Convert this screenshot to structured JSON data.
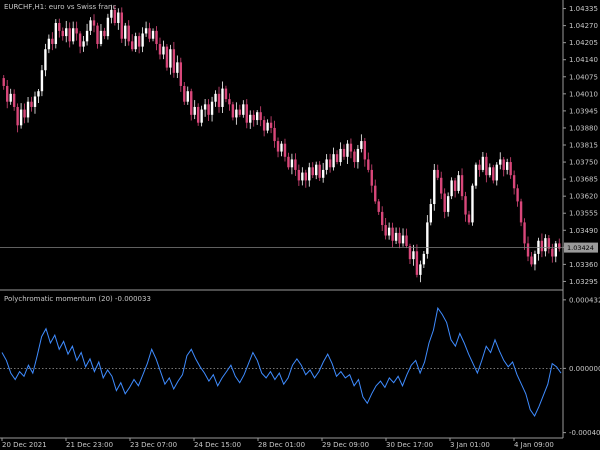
{
  "chart_title": "EURCHF,H1:  euro vs Swiss franc",
  "indicator_title": "Polychromatic momentum (20) -0.000033",
  "colors": {
    "background": "#000000",
    "up_candle": "#ffffff",
    "down_candle": "#d9477a",
    "indicator_line": "#3f8cff",
    "grid_line": "#9a9a9a",
    "current_price_line": "#808080",
    "price_tag": "#9a9a9a"
  },
  "chart_data": [
    {
      "type": "candlestick",
      "title": "EURCHF,H1:  euro vs Swiss franc",
      "y_ticks": [
        "1.04335",
        "1.04270",
        "1.04205",
        "1.04140",
        "1.04075",
        "1.04010",
        "1.03945",
        "1.03880",
        "1.03815",
        "1.03750",
        "1.03685",
        "1.03620",
        "1.03555",
        "1.03490",
        "1.03425",
        "1.03360",
        "1.03295"
      ],
      "ylim": [
        1.0327,
        1.0436
      ],
      "current_price": "1.03424",
      "x_ticks": [
        "20 Dec 2021",
        "21 Dec 23:00",
        "23 Dec 07:00",
        "24 Dec 15:00",
        "28 Dec 01:00",
        "29 Dec 09:00",
        "30 Dec 17:00",
        "3 Jan 01:00",
        "4 Jan 09:00"
      ],
      "close": [
        1.0404,
        1.0398,
        1.0401,
        1.0396,
        1.0389,
        1.0395,
        1.0392,
        1.0398,
        1.0396,
        1.04,
        1.0402,
        1.041,
        1.0418,
        1.0422,
        1.042,
        1.0428,
        1.0425,
        1.0423,
        1.0426,
        1.0421,
        1.0426,
        1.0424,
        1.0419,
        1.0421,
        1.0425,
        1.0429,
        1.0427,
        1.042,
        1.0425,
        1.0423,
        1.043,
        1.0433,
        1.0428,
        1.0432,
        1.0422,
        1.0427,
        1.0421,
        1.0418,
        1.0423,
        1.0419,
        1.0424,
        1.0426,
        1.0422,
        1.0425,
        1.042,
        1.0416,
        1.0419,
        1.0411,
        1.0418,
        1.0409,
        1.0413,
        1.0404,
        1.0398,
        1.0402,
        1.0393,
        1.0396,
        1.039,
        1.0395,
        1.0397,
        1.0393,
        1.0398,
        1.0401,
        1.0396,
        1.0403,
        1.0399,
        1.0397,
        1.0392,
        1.0395,
        1.0393,
        1.0397,
        1.039,
        1.0393,
        1.0391,
        1.0394,
        1.0391,
        1.0387,
        1.039,
        1.0388,
        1.0383,
        1.0379,
        1.0382,
        1.0377,
        1.0373,
        1.0376,
        1.0372,
        1.0368,
        1.0371,
        1.0368,
        1.0373,
        1.037,
        1.0374,
        1.0369,
        1.0372,
        1.0376,
        1.0373,
        1.0378,
        1.0375,
        1.038,
        1.0377,
        1.0382,
        1.0379,
        1.0375,
        1.038,
        1.0383,
        1.0376,
        1.0372,
        1.0366,
        1.036,
        1.0356,
        1.0351,
        1.0347,
        1.035,
        1.0345,
        1.0348,
        1.0344,
        1.0347,
        1.0343,
        1.0338,
        1.0341,
        1.0332,
        1.0336,
        1.034,
        1.0352,
        1.0359,
        1.0372,
        1.0369,
        1.0363,
        1.0356,
        1.0362,
        1.0368,
        1.0364,
        1.037,
        1.0362,
        1.0355,
        1.0352,
        1.0366,
        1.0374,
        1.0372,
        1.0377,
        1.037,
        1.0373,
        1.0368,
        1.0374,
        1.0376,
        1.0372,
        1.0375,
        1.037,
        1.0365,
        1.036,
        1.0352,
        1.0344,
        1.0339,
        1.0336,
        1.034,
        1.0345,
        1.0341,
        1.0346,
        1.0342,
        1.0339,
        1.0344,
        1.0342
      ]
    },
    {
      "type": "line",
      "title": "Polychromatic momentum (20) -0.000033",
      "y_ticks": [
        "0.000432",
        "0.000000",
        "-0.000405"
      ],
      "ylim": [
        -0.00042,
        0.00045
      ],
      "zero_line": 0,
      "series": [
        {
          "values": [
            0.0001,
            5e-05,
            -3e-05,
            -7e-05,
            -2e-05,
            -5e-05,
            2e-05,
            -3e-05,
            8e-05,
            0.0002,
            0.00025,
            0.00016,
            0.00021,
            0.00012,
            0.00017,
            9e-05,
            0.00014,
            5e-05,
            0.0001,
            1e-05,
            6e-05,
            -2e-05,
            4e-05,
            -6e-05,
            -1e-05,
            -5e-05,
            -0.00014,
            -9e-05,
            -0.00016,
            -0.00012,
            -7e-05,
            -0.00011,
            -4e-05,
            3e-05,
            0.00012,
            6e-05,
            -2e-05,
            -0.0001,
            -6e-05,
            -0.00013,
            -8e-05,
            -4e-05,
            8e-05,
            0.00012,
            6e-05,
            1e-05,
            -3e-05,
            -8e-05,
            -4e-05,
            -0.00011,
            -6e-05,
            -2e-05,
            2e-05,
            -5e-05,
            -9e-05,
            -4e-05,
            3e-05,
            0.0001,
            5e-05,
            -3e-05,
            -6e-05,
            -2e-05,
            -7e-05,
            -3e-05,
            -0.0001,
            -6e-05,
            2e-05,
            6e-05,
            2e-05,
            -4e-05,
            -1e-05,
            -6e-05,
            -2e-05,
            4e-05,
            9e-05,
            3e-05,
            -5e-05,
            -2e-05,
            -6e-05,
            -4e-05,
            -0.00011,
            -7e-05,
            -0.00018,
            -0.00022,
            -0.00016,
            -0.00011,
            -8e-05,
            -0.00012,
            -6e-05,
            -9e-05,
            -5e-05,
            -0.00011,
            -4e-05,
            2e-05,
            5e-05,
            -3e-05,
            4e-05,
            0.00016,
            0.00024,
            0.00038,
            0.00034,
            0.00029,
            0.00018,
            0.00014,
            0.00022,
            0.00016,
            9e-05,
            3e-05,
            -3e-05,
            5e-05,
            0.00014,
            0.0001,
            0.00018,
            0.00011,
            5e-05,
            1e-05,
            4e-05,
            -4e-05,
            -0.0001,
            -0.00016,
            -0.00026,
            -0.0003,
            -0.00024,
            -0.00017,
            -0.0001,
            3e-05,
            1e-05,
            -3e-05
          ]
        }
      ]
    }
  ]
}
